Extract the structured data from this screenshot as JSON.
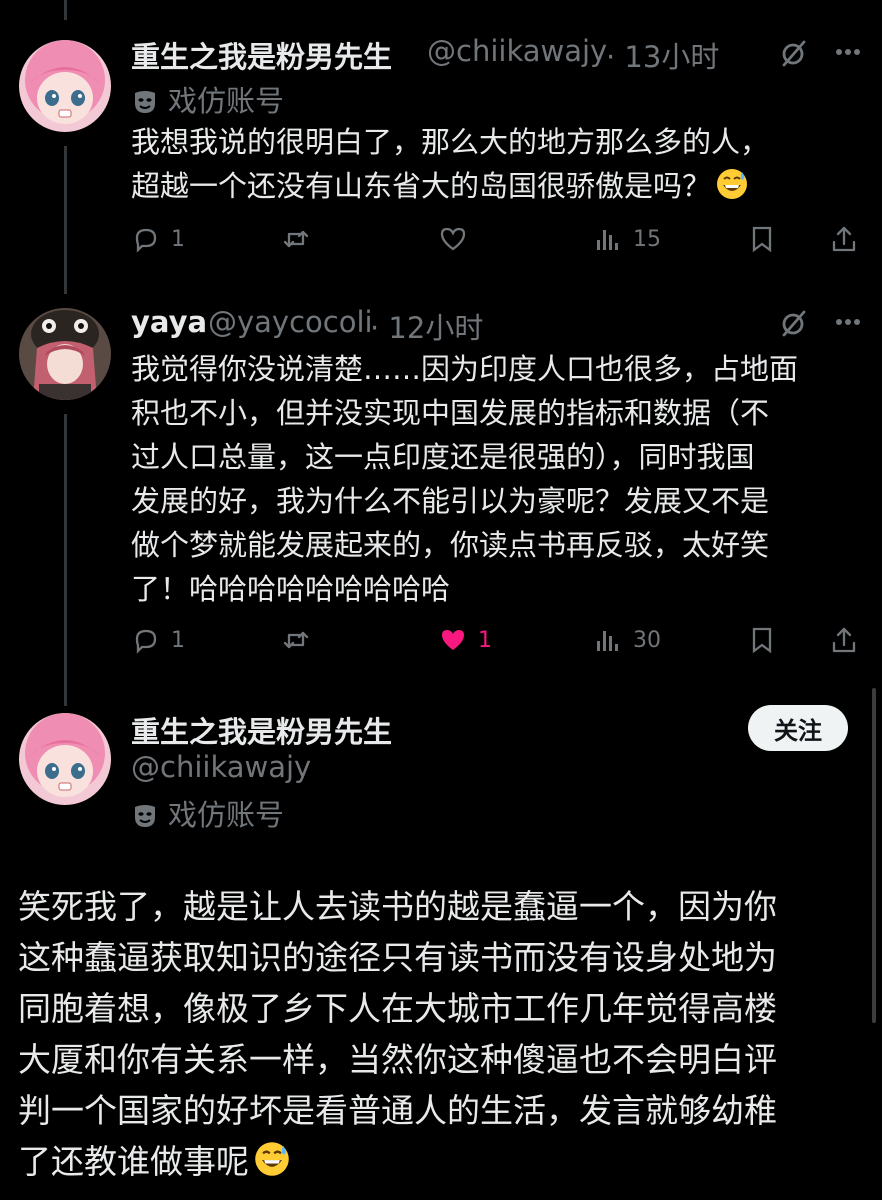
{
  "post1": {
    "display_name": "重生之我是粉男先生",
    "handle": "@chiikawajy",
    "time": "· 13小时",
    "parody_label": "戏仿账号",
    "lines": [
      "我想我说的很明白了，那么大的地方那么多的人，",
      "超越一个还没有山东省大的岛国很骄傲是吗？"
    ],
    "emoji": "sweat-smile-emoji",
    "reply_count": "1",
    "view_count": "15"
  },
  "post2": {
    "display_name": "yaya",
    "handle": "@yaycocoli",
    "time": "· 12小时",
    "lines": [
      "我觉得你没说清楚……因为印度人口也很多，占地面",
      "积也不小，但并没实现中国发展的指标和数据（不",
      "过人口总量，这一点印度还是很强的），同时我国",
      "发展的好，我为什么不能引以为豪呢？发展又不是",
      "做个梦就能发展起来的，你读点书再反驳，太好笑",
      "了！哈哈哈哈哈哈哈哈哈"
    ],
    "reply_count": "1",
    "like_count": "1",
    "view_count": "30",
    "like_color": "#f91880"
  },
  "post3": {
    "display_name": "重生之我是粉男先生",
    "handle": "@chiikawajy",
    "parody_label": "戏仿账号",
    "follow_label": "关注",
    "lines": [
      "笑死我了，越是让人去读书的越是蠢逼一个，因为你",
      "这种蠢逼获取知识的途径只有读书而没有设身处地为",
      "同胞着想，像极了乡下人在大城市工作几年觉得高楼",
      "大厦和你有关系一样，当然你这种傻逼也不会明白评",
      "判一个国家的好坏是看普通人的生活，发言就够幼稚",
      "了还教谁做事呢"
    ],
    "emoji": "sweat-smile-emoji"
  },
  "icons": {
    "reply": "reply-icon",
    "repost": "repost-icon",
    "like": "heart-icon",
    "views": "views-icon",
    "bookmark": "bookmark-icon",
    "share": "share-icon",
    "grok": "grok-icon",
    "more": "more-icon",
    "parody": "parody-mask-icon"
  }
}
